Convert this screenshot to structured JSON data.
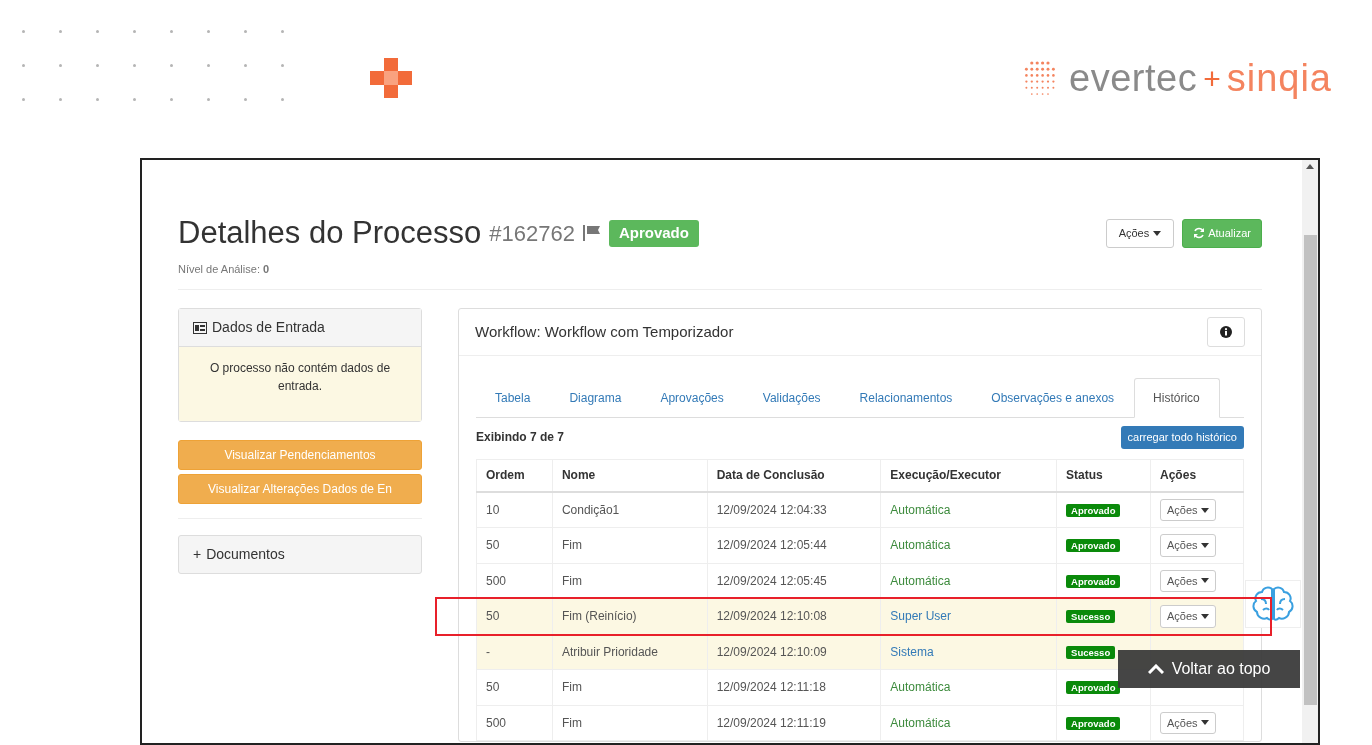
{
  "header": {
    "logo": {
      "brand": "evertec",
      "plus": "+",
      "partner": "sinqia"
    }
  },
  "page": {
    "title": "Detalhes do Processo",
    "process_id": "#162762",
    "status_badge": "Aprovado",
    "analysis_level": "Nível de Análise: **0**",
    "actions_button": "Ações",
    "refresh_button": "Atualizar"
  },
  "input_panel": {
    "title": "Dados de Entrada",
    "message": "O processo não contém dados de entrada."
  },
  "side_buttons": [
    "Visualizar Pendenciamentos",
    "Visualizar Alterações Dados de En"
  ],
  "documents_panel": {
    "toggle": "+",
    "title": "Documentos"
  },
  "workflow": {
    "title": "Workflow: Workflow com Temporizador",
    "tabs": [
      {
        "label": "Tabela",
        "selected": false
      },
      {
        "label": "Diagrama",
        "selected": false
      },
      {
        "label": "Aprovações",
        "selected": false
      },
      {
        "label": "Validações",
        "selected": false
      },
      {
        "label": "Relacionamentos",
        "selected": false
      },
      {
        "label": "Observações e anexos",
        "selected": false
      },
      {
        "label": "Histórico",
        "selected": true
      }
    ],
    "count": "Exibindo 7 de 7",
    "load_all_button": "carregar todo histórico",
    "table": {
      "columns": [
        "Ordem",
        "Nome",
        "Data de Conclusão",
        "Execução/Executor",
        "Status",
        "Ações"
      ],
      "rows": [
        {
          "order": "10",
          "name": "Condição1",
          "date": "12/09/2024 12:04:33",
          "executor": {
            "text": "Automática",
            "color": "#3d8b3d"
          },
          "status": "Aprovado",
          "actions": "Ações",
          "highlighted": false,
          "annotated": false
        },
        {
          "order": "50",
          "name": "Fim",
          "date": "12/09/2024 12:05:44",
          "executor": {
            "text": "Automática",
            "color": "#3d8b3d"
          },
          "status": "Aprovado",
          "actions": "Ações",
          "highlighted": false,
          "annotated": false
        },
        {
          "order": "500",
          "name": "Fim",
          "date": "12/09/2024 12:05:45",
          "executor": {
            "text": "Automática",
            "color": "#3d8b3d"
          },
          "status": "Aprovado",
          "actions": "Ações",
          "highlighted": false,
          "annotated": false
        },
        {
          "order": "50",
          "name": "Fim (Reinício)",
          "date": "12/09/2024 12:10:08",
          "executor": {
            "text": "Super User",
            "color": "#337ab7"
          },
          "status": "Sucesso",
          "actions": "Ações",
          "highlighted": true,
          "annotated": true
        },
        {
          "order": "-",
          "name": "Atribuir Prioridade",
          "date": "12/09/2024 12:10:09",
          "executor": {
            "text": "Sistema",
            "color": "#337ab7"
          },
          "status": "Sucesso",
          "highlighted": true,
          "annotated": false
        },
        {
          "order": "50",
          "name": "Fim",
          "date": "12/09/2024 12:11:18",
          "executor": {
            "text": "Automática",
            "color": "#3d8b3d"
          },
          "status": "Aprovado",
          "highlighted": false,
          "annotated": false
        },
        {
          "order": "500",
          "name": "Fim",
          "date": "12/09/2024 12:11:19",
          "executor": {
            "text": "Automática",
            "color": "#3d8b3d"
          },
          "status": "Aprovado",
          "actions": "Ações",
          "highlighted": false,
          "annotated": false
        }
      ]
    }
  },
  "back_to_top": "Voltar ao topo"
}
